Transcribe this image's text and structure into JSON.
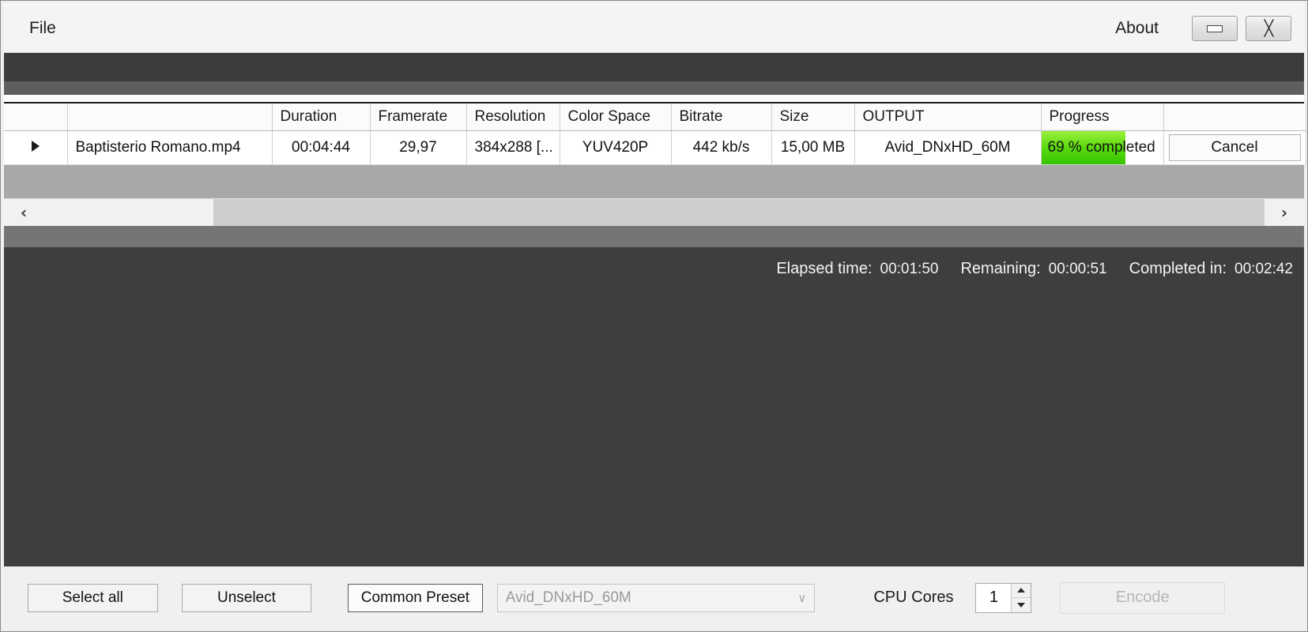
{
  "window": {
    "menu": [
      {
        "label": "File"
      }
    ],
    "about_label": "About",
    "minimize_icon": "minimize-icon",
    "close_icon": "close-icon"
  },
  "table": {
    "columns": [
      {
        "key": "sel",
        "label": ""
      },
      {
        "key": "name",
        "label": ""
      },
      {
        "key": "duration",
        "label": "Duration"
      },
      {
        "key": "framerate",
        "label": "Framerate"
      },
      {
        "key": "resolution",
        "label": "Resolution"
      },
      {
        "key": "colorspace",
        "label": "Color Space"
      },
      {
        "key": "bitrate",
        "label": "Bitrate"
      },
      {
        "key": "size",
        "label": "Size"
      },
      {
        "key": "output",
        "label": "OUTPUT"
      },
      {
        "key": "progress",
        "label": "Progress"
      },
      {
        "key": "action",
        "label": ""
      }
    ],
    "rows": [
      {
        "selector": "row-selected-arrow",
        "name": "Baptisterio Romano.mp4",
        "duration": "00:04:44",
        "framerate": "29,97",
        "resolution": "384x288 [...",
        "colorspace": "YUV420P",
        "bitrate": "442 kb/s",
        "size": "15,00 MB",
        "output": "Avid_DNxHD_60M",
        "progress_text": "69 % completed",
        "progress_percent": 69,
        "progress_color": "#4fd80a",
        "action_label": "Cancel"
      }
    ]
  },
  "scrollbar": {
    "left_arrow": "‹",
    "right_arrow": "›"
  },
  "status": {
    "elapsed_label": "Elapsed time:",
    "elapsed_value": "00:01:50",
    "remaining_label": "Remaining:",
    "remaining_value": "00:00:51",
    "completed_label": "Completed in:",
    "completed_value": "00:02:42"
  },
  "toolbar": {
    "select_all_label": "Select all",
    "unselect_label": "Unselect",
    "common_preset_label": "Common Preset",
    "preset_value": "Avid_DNxHD_60M",
    "preset_chevron": "∨",
    "cpu_cores_label": "CPU Cores",
    "cpu_cores_value": "1",
    "encode_label": "Encode"
  }
}
